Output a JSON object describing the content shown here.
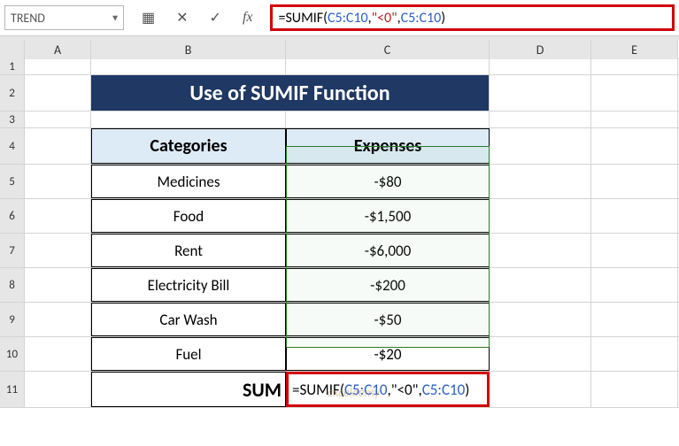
{
  "nameBox": "TREND",
  "formulaBar": {
    "prefix": "=SUMIF(",
    "arg1": "C5:C10",
    "comma1": ",",
    "arg2": "\"<0\"",
    "comma2": ",",
    "arg3": "C5:C10",
    "suffix": ")"
  },
  "fxLabel": "fx",
  "columns": {
    "A": "A",
    "B": "B",
    "C": "C",
    "D": "D",
    "E": "E"
  },
  "rows": {
    "r1": "1",
    "r2": "2",
    "r3": "3",
    "r4": "4",
    "r5": "5",
    "r6": "6",
    "r7": "7",
    "r8": "8",
    "r9": "9",
    "r10": "10",
    "r11": "11"
  },
  "title": "Use of SUMIF Function",
  "headers": {
    "cat": "Categories",
    "exp": "Expenses"
  },
  "data": [
    {
      "cat": "Medicines",
      "exp": "-$80"
    },
    {
      "cat": "Food",
      "exp": "-$1,500"
    },
    {
      "cat": "Rent",
      "exp": "-$6,000"
    },
    {
      "cat": "Electricity Bill",
      "exp": "-$200"
    },
    {
      "cat": "Car Wash",
      "exp": "-$50"
    },
    {
      "cat": "Fuel",
      "exp": "-$20"
    }
  ],
  "sumLabel": "SUM",
  "cellFormula": {
    "prefix": "=SUMIF(",
    "arg1": "C5:C10",
    "comma1": ",",
    "arg2": "\"<0\"",
    "comma2": ",",
    "arg3": "C5:C10",
    "suffix": ")"
  },
  "watermark": "exceldemy"
}
